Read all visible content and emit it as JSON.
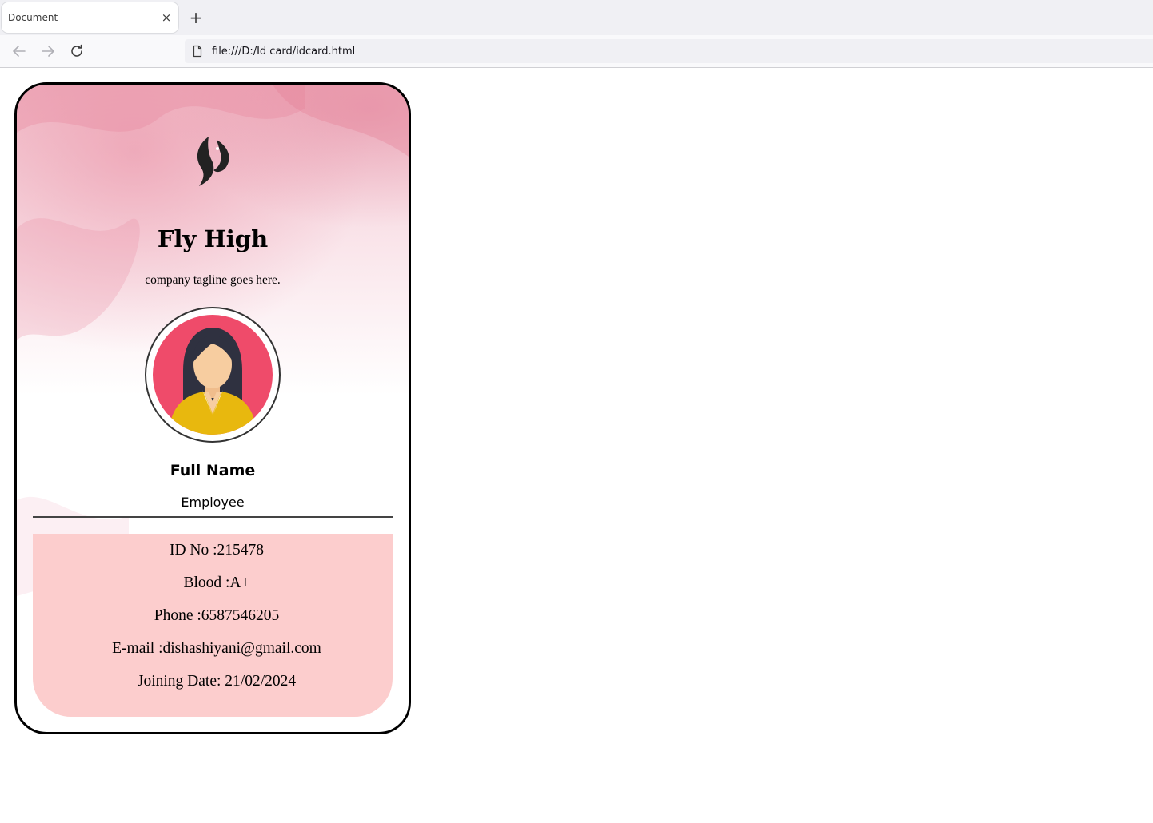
{
  "browser": {
    "tab_title": "Document",
    "tab_close": "×",
    "new_tab": "+",
    "url": "file:///D:/Id card/idcard.html"
  },
  "card": {
    "company_name": "Fly High",
    "tagline": "company tagline goes here.",
    "full_name": "Full Name",
    "role": "Employee",
    "details": {
      "id": "ID No :215478",
      "blood": "Blood :A+",
      "phone": "Phone :6587546205",
      "email": "E-mail :dishashiyani@gmail.com",
      "joining": "Joining Date: 21/02/2024"
    }
  },
  "colors": {
    "card_border": "#000000",
    "info_panel": "#fccdcd",
    "avatar_bg": "#ef4b6a",
    "shirt": "#e8b80e",
    "skin": "#f7cda0",
    "hair": "#2f3140"
  },
  "icons": {
    "back": "arrow-left-icon",
    "forward": "arrow-right-icon",
    "reload": "reload-icon",
    "page": "document-icon",
    "logo": "phoenix-logo-icon",
    "avatar": "female-employee-avatar"
  }
}
